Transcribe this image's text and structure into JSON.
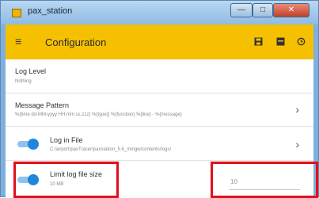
{
  "window": {
    "title": "pax_station",
    "controls": {
      "minimize": "—",
      "maximize": "□",
      "close": "✕"
    }
  },
  "toolbar": {
    "title": "Configuration",
    "icons": [
      "menu-icon",
      "save-icon",
      "save-all-icon",
      "reset-icon"
    ]
  },
  "settings": {
    "log_level": {
      "label": "Log Level",
      "value": "Nothing"
    },
    "message_pattern": {
      "label": "Message Pattern",
      "value": "%{time dd-MM-yyyy HH:mm:ss.zzz} %{type}] %{function} %{line} - %{message}"
    },
    "log_in_file": {
      "label": "Log in File",
      "value": "C:/airport/paxTracer/paxstation_5.6_mingw/contents/logs/",
      "enabled": true
    },
    "limit_log_size": {
      "label": "Limit log file size",
      "value": "10 MB",
      "enabled": true
    },
    "size_input": {
      "value": "10"
    }
  },
  "colors": {
    "toolbar": "#f5c000",
    "toggle": "#1f86dc",
    "highlight": "#e0101a"
  }
}
